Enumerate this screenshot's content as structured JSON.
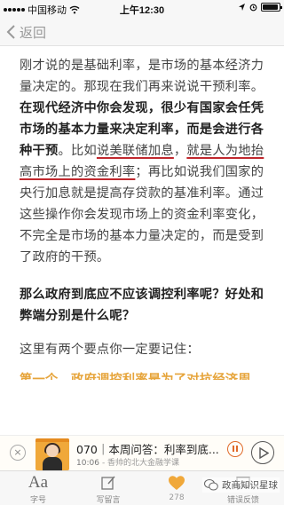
{
  "status_bar": {
    "carrier": "中国移动",
    "time": "上午12:30"
  },
  "nav": {
    "back_label": "返回"
  },
  "article": {
    "p1_a": "刚才说的是基础利率，是市场的基本经济力量决定的。那现在我们再来说说干预利率。",
    "p1_b": "在现代经济中你会发现，很少有国家会任凭市场的基本力量来决定利率，而是会进行各种干预",
    "p1_c": "。比如",
    "p1_u1": "说美联储加息",
    "p1_d": "，",
    "p1_u2": "就是人为地抬高市场上的资金利率",
    "p1_e": "；再比如说我们国家的央行加息就是提高存贷款的基准利率",
    "p1_f": "。通过这些操作你会发现市场上的资金利率变化，不完全是市场的基本力量决定的，而是受到了政府的干预。",
    "heading": "那么政府到底应不应该调控利率呢？好处和弊端分别是什么呢？",
    "p2": "这里有两个要点你一定要记住：",
    "p3": "第一个，政府调控利率是为了对抗经济周"
  },
  "player": {
    "close_icon_label": "×",
    "title": "070｜本周问答：利率到底...",
    "time": "10:06",
    "source": "- 香帅的北大金融学课"
  },
  "tabs": {
    "font": {
      "icon_text": "Aa",
      "label": "字号"
    },
    "comment": {
      "label": "写留言"
    },
    "like": {
      "label": "278"
    },
    "feedback": {
      "label": "错误反馈"
    }
  },
  "watermark": {
    "text": "政商知识星球"
  },
  "colors": {
    "accent_orange": "#f0a83a",
    "underline_red": "#c0282e",
    "heart": "#f0a83a"
  }
}
